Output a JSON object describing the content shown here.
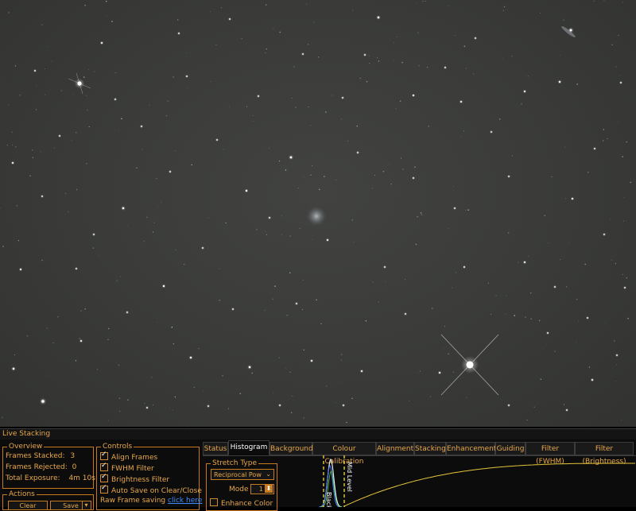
{
  "image": {
    "name": "star-field",
    "stars": [
      [
        100,
        105,
        2.6
      ],
      [
        718,
        38,
        1.5
      ],
      [
        591,
        459,
        4.5
      ],
      [
        54,
        505,
        1.8
      ],
      [
        476,
        22,
        1.2
      ],
      [
        366,
        198,
        1.3
      ],
      [
        310,
        240,
        1.1
      ],
      [
        155,
        262,
        1.2
      ],
      [
        206,
        360,
        1.1
      ],
      [
        240,
        450,
        1.1
      ],
      [
        412,
        302,
        1.0
      ],
      [
        660,
        330,
        1.0
      ],
      [
        704,
        103,
        1.1
      ],
      [
        520,
        120,
        1.0
      ],
      [
        580,
        128,
        1.0
      ],
      [
        720,
        250,
        1.0
      ],
      [
        17,
        464,
        1.2
      ],
      [
        102,
        429,
        1.0
      ],
      [
        314,
        462,
        1.2
      ],
      [
        392,
        454,
        1.0
      ],
      [
        455,
        467,
        1.0
      ],
      [
        553,
        469,
        1.0
      ],
      [
        745,
        478,
        1.0
      ],
      [
        660,
        115,
        1.0
      ],
      [
        128,
        54,
        1.0
      ],
      [
        225,
        42,
        0.9
      ],
      [
        289,
        24,
        0.9
      ],
      [
        381,
        68,
        0.9
      ],
      [
        431,
        123,
        0.9
      ],
      [
        44,
        89,
        0.9
      ],
      [
        16,
        205,
        1.0
      ],
      [
        26,
        339,
        1.0
      ],
      [
        160,
        393,
        0.9
      ],
      [
        255,
        312,
        0.9
      ],
      [
        510,
        395,
        0.9
      ],
      [
        689,
        419,
        0.9
      ],
      [
        739,
        400,
        0.9
      ],
      [
        776,
        447,
        0.9
      ],
      [
        760,
        295,
        0.9
      ],
      [
        640,
        222,
        0.9
      ],
      [
        520,
        224,
        0.9
      ],
      [
        450,
        192,
        0.9
      ],
      [
        339,
        274,
        0.9
      ],
      [
        273,
        176,
        0.9
      ],
      [
        178,
        159,
        0.9
      ],
      [
        75,
        171,
        0.9
      ],
      [
        53,
        247,
        0.9
      ],
      [
        118,
        295,
        0.9
      ],
      [
        185,
        513,
        0.9
      ],
      [
        262,
        511,
        0.9
      ],
      [
        352,
        510,
        0.9
      ],
      [
        432,
        510,
        0.9
      ],
      [
        640,
        510,
        0.9
      ],
      [
        713,
        516,
        0.9
      ],
      [
        781,
        104,
        0.9
      ],
      [
        598,
        48,
        0.9
      ],
      [
        560,
        85,
        0.9
      ],
      [
        459,
        69,
        0.9
      ],
      [
        325,
        121,
        0.9
      ],
      [
        214,
        216,
        0.9
      ],
      [
        96,
        338,
        0.9
      ],
      [
        293,
        389,
        0.9
      ],
      [
        373,
        382,
        0.9
      ],
      [
        484,
        336,
        0.9
      ],
      [
        584,
        336,
        0.9
      ],
      [
        698,
        361,
        0.9
      ],
      [
        786,
        362,
        0.9
      ],
      [
        748,
        187,
        0.9
      ],
      [
        618,
        166,
        0.9
      ],
      [
        572,
        262,
        0.9
      ],
      [
        235,
        96,
        0.9
      ],
      [
        145,
        125,
        0.9
      ]
    ],
    "galaxy": [
      398,
      272
    ]
  },
  "panel": {
    "title": "Live Stacking",
    "overview": {
      "title": "Overview",
      "frames_stacked_label": "Frames Stacked:",
      "frames_stacked": "3",
      "frames_rejected_label": "Frames Rejected:",
      "frames_rejected": "0",
      "total_exposure_label": "Total Exposure:",
      "total_exposure": "4m 10s"
    },
    "actions": {
      "title": "Actions",
      "clear_label": "Clear",
      "save_label": "Save",
      "save_menu_glyph": "▾"
    },
    "controls": {
      "title": "Controls",
      "align_frames": "Align Frames",
      "fwhm_filter": "FWHM Filter",
      "brightness_filter": "Brightness Filter",
      "auto_save": "Auto Save on Clear/Close",
      "raw_saving_label": "Raw Frame saving",
      "raw_saving_link": "click here"
    },
    "tabs": [
      "Status",
      "Histogram",
      "Background",
      "Colour Calibration",
      "Alignment",
      "Stacking",
      "Enhancement",
      "Guiding",
      "Filter (FWHM)",
      "Filter (Brightness)"
    ],
    "active_tab": "Histogram",
    "histogram": {
      "stretch_type_title": "Stretch Type",
      "stretch_type_value": "Reciprocal Pow",
      "dropdown_glyph": "⌄",
      "mode_label": "Mode",
      "mode_value": "1",
      "spin_glyph": "⬍",
      "enhance_color": "Enhance Color",
      "black_label": "Black",
      "mid_label": "Mid Level"
    },
    "colors": {
      "accent": "#e8a84a",
      "border": "#c77a1e",
      "link": "#3d8bff",
      "curve": "#e5c53a",
      "marker": "#ffee44"
    }
  }
}
